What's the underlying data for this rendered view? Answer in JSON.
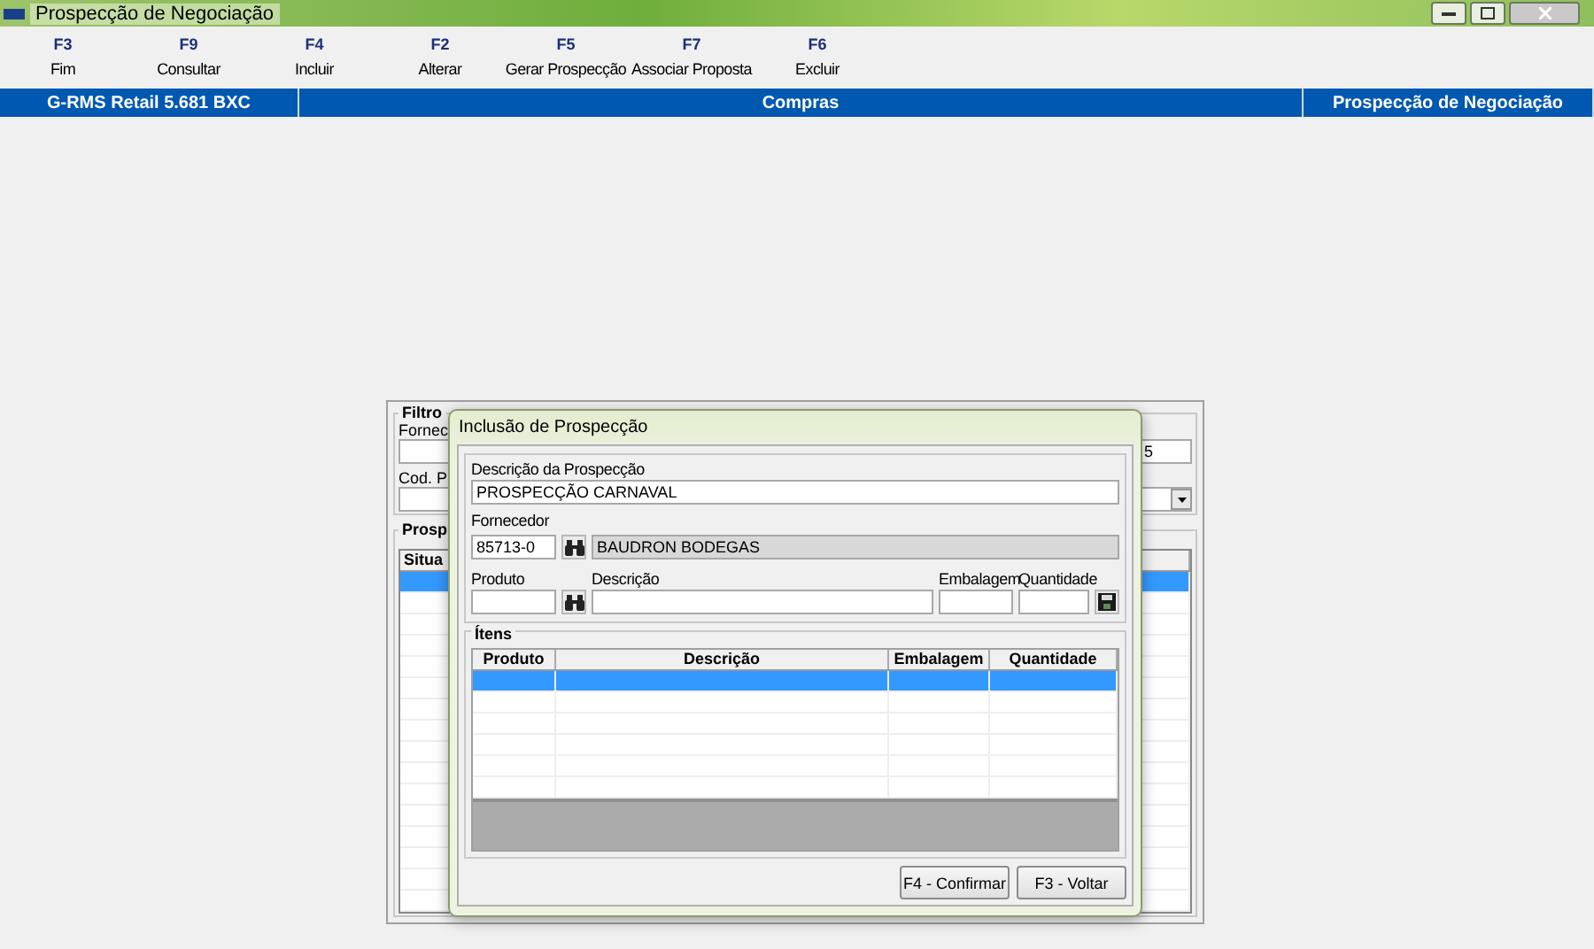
{
  "window": {
    "title": "Prospecção de Negociação"
  },
  "toolbar": [
    {
      "key": "F3",
      "label": "Fim"
    },
    {
      "key": "F9",
      "label": "Consultar"
    },
    {
      "key": "F4",
      "label": "Incluir"
    },
    {
      "key": "F2",
      "label": "Alterar"
    },
    {
      "key": "F5",
      "label": "Gerar Prospecção"
    },
    {
      "key": "F7",
      "label": "Associar Proposta"
    },
    {
      "key": "F6",
      "label": "Excluir"
    }
  ],
  "header_bar": [
    "G-RMS Retail 5.681 BXC",
    "Compras",
    "Prospecção de Negociação"
  ],
  "background_form": {
    "filter_title": "Filtro",
    "supplier_label": "Fornec",
    "date_text": "5",
    "product_label": "Cod. P",
    "list_title": "Prosp",
    "column_1": "Situa",
    "rows": [
      {
        "selected": true
      },
      {
        "selected": false
      },
      {
        "selected": false
      },
      {
        "selected": false
      },
      {
        "selected": false
      },
      {
        "selected": false
      },
      {
        "selected": false
      },
      {
        "selected": false
      },
      {
        "selected": false
      },
      {
        "selected": false
      },
      {
        "selected": false
      },
      {
        "selected": false
      },
      {
        "selected": false
      },
      {
        "selected": false
      },
      {
        "selected": false
      },
      {
        "selected": false
      }
    ]
  },
  "dialog": {
    "title": "Inclusão de Prospecção",
    "description_label": "Descrição da Prospecção",
    "description_value": "PROSPECÇÃO CARNAVAL",
    "supplier_label": "Fornecedor",
    "supplier_code": "85713-0",
    "supplier_name": "BAUDRON BODEGAS",
    "item_labels": [
      "Produto",
      "Descrição",
      "Embalagem",
      "Quantidade"
    ],
    "items_title": "Ítens",
    "columns": [
      "Produto",
      "Descrição",
      "Embalagem",
      "Quantidade"
    ],
    "rows": [
      {
        "selected": true
      },
      {
        "selected": false
      },
      {
        "selected": false
      },
      {
        "selected": false
      },
      {
        "selected": false
      },
      {
        "selected": false
      }
    ],
    "buttons": [
      "F4 - Confirmar",
      "F3 - Voltar"
    ]
  }
}
